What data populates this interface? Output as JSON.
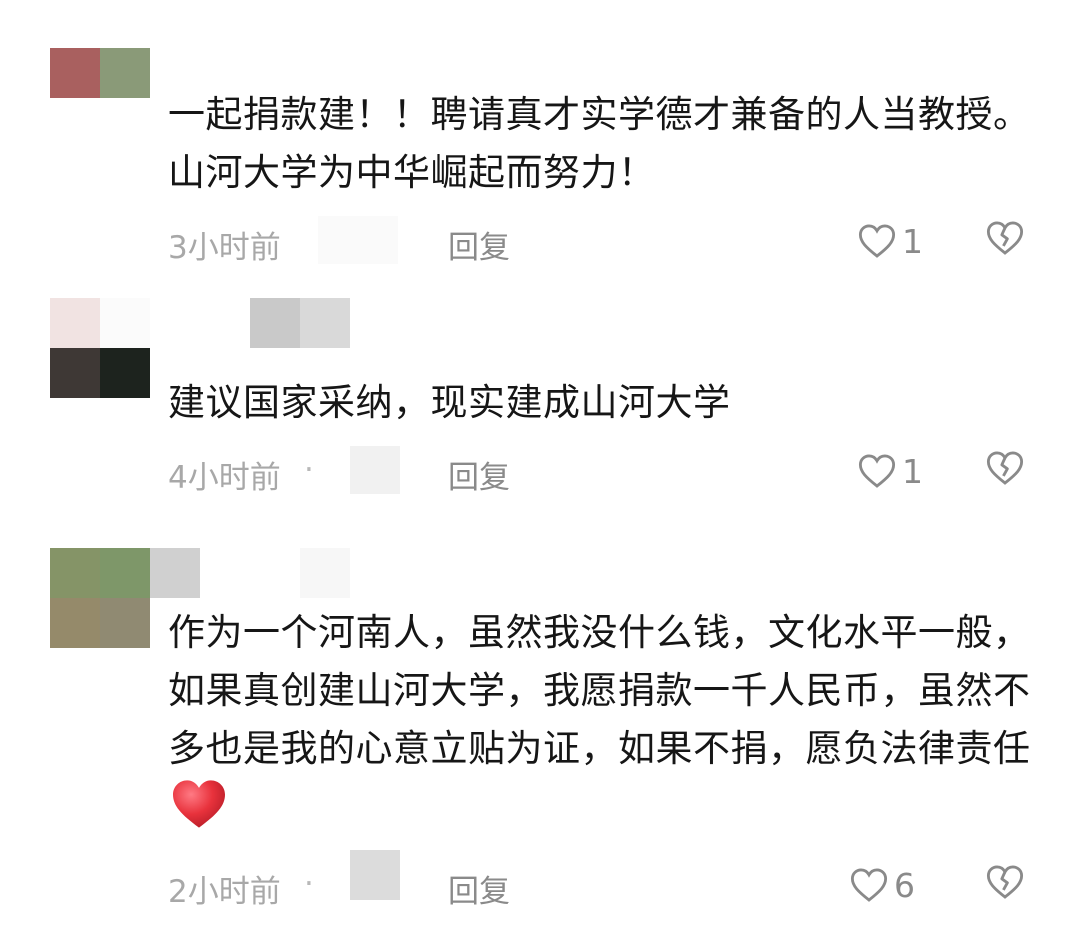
{
  "comments": [
    {
      "text": "一起捐款建！！聘请真才实学德才兼备的人当教授。山河大学为中华崛起而努力！",
      "time": "3小时前",
      "reply_label": "回复",
      "like_count": "1"
    },
    {
      "text": "建议国家采纳，现实建成山河大学",
      "time": "4小时前",
      "separator": "·",
      "reply_label": "回复",
      "like_count": "1"
    },
    {
      "text": "作为一个河南人，虽然我没什么钱，文化水平一般，如果真创建山河大学，我愿捐款一千人民币，虽然不多也是我的心意立贴为证，如果不捐，愿负法律责任",
      "time": "2小时前",
      "separator": "·",
      "reply_label": "回复",
      "like_count": "6"
    }
  ],
  "icons": {
    "like": "heart-outline-icon",
    "dislike": "broken-heart-icon",
    "emoji": "red-heart-emoji"
  },
  "colors": {
    "text": "#161616",
    "meta": "#a8a8a8",
    "icon": "#8a8a8a",
    "emoji": "#e8323c"
  }
}
